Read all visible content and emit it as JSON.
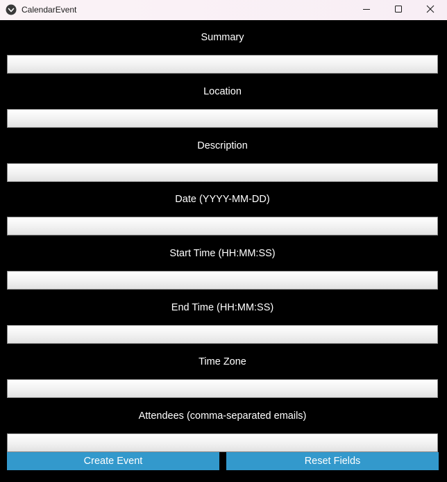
{
  "window": {
    "title": "CalendarEvent",
    "icon": "app-logo-icon",
    "controls": {
      "minimize": "minimize-icon",
      "maximize": "maximize-icon",
      "close": "close-icon"
    }
  },
  "form": {
    "fields": [
      {
        "label": "Summary",
        "value": "",
        "placeholder": ""
      },
      {
        "label": "Location",
        "value": "",
        "placeholder": ""
      },
      {
        "label": "Description",
        "value": "",
        "placeholder": ""
      },
      {
        "label": "Date (YYYY-MM-DD)",
        "value": "",
        "placeholder": ""
      },
      {
        "label": "Start Time (HH:MM:SS)",
        "value": "",
        "placeholder": ""
      },
      {
        "label": "End Time (HH:MM:SS)",
        "value": "",
        "placeholder": ""
      },
      {
        "label": "Time Zone",
        "value": "",
        "placeholder": ""
      },
      {
        "label": "Attendees (comma-separated emails)",
        "value": "",
        "placeholder": ""
      }
    ],
    "buttons": {
      "create_label": "Create Event",
      "reset_label": "Reset Fields"
    }
  },
  "colors": {
    "background": "#000000",
    "button": "#3399cc",
    "label_text": "#ffffff"
  }
}
